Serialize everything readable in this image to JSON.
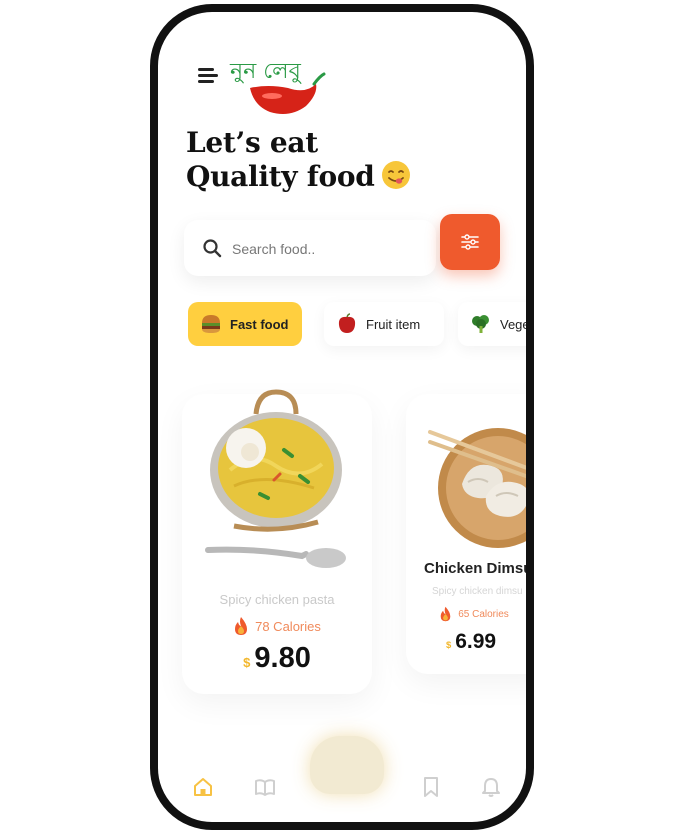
{
  "app": {
    "logo_text": "নুন লেবু"
  },
  "headline": {
    "line1": "Let’s eat",
    "line2": "Quality food"
  },
  "search": {
    "placeholder": "Search food.."
  },
  "categories": [
    {
      "label": "Fast food",
      "icon": "burger-icon",
      "active": true
    },
    {
      "label": "Fruit item",
      "icon": "fruit-icon",
      "active": false
    },
    {
      "label": "Veget",
      "icon": "broccoli-icon",
      "active": false
    }
  ],
  "foods": [
    {
      "name": "Spicy chicken pasta",
      "calories": "78 Calories",
      "currency": "$",
      "price": "9.80"
    },
    {
      "name": "Chicken Dimsu",
      "subtitle": "Spicy chicken dimsu",
      "calories": "65 Calories",
      "currency": "$",
      "price": "6.99"
    }
  ],
  "tab_bar": {
    "tabs": [
      "home-icon",
      "book-icon",
      "bookmark-icon",
      "bell-icon"
    ],
    "active": "home-icon"
  },
  "colors": {
    "accent": "#ef5a2d",
    "active_chip": "#ffcf3f",
    "calories": "#f08a5b",
    "price_currency": "#f2b72c"
  }
}
